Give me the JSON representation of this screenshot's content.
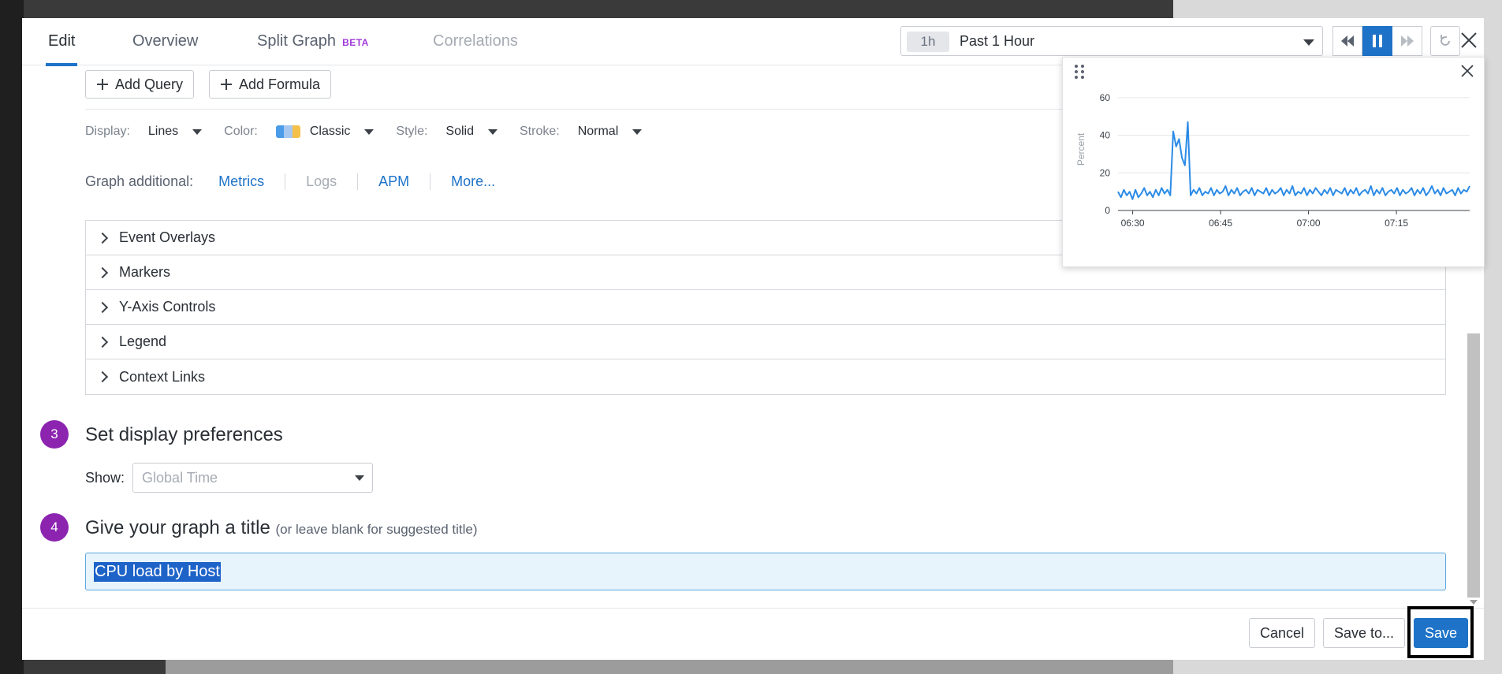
{
  "tabs": [
    {
      "label": "Edit"
    },
    {
      "label": "Overview"
    },
    {
      "label": "Split Graph",
      "badge": "BETA"
    },
    {
      "label": "Correlations"
    }
  ],
  "timepicker": {
    "badge": "1h",
    "label": "Past 1 Hour"
  },
  "buttons": {
    "add_query": "Add Query",
    "add_formula": "Add Formula"
  },
  "display": {
    "display_label": "Display:",
    "display_value": "Lines",
    "color_label": "Color:",
    "color_value": "Classic",
    "style_label": "Style:",
    "style_value": "Solid",
    "stroke_label": "Stroke:",
    "stroke_value": "Normal",
    "palette": [
      "#4a9be8",
      "#a6c8f0",
      "#f5c04a"
    ]
  },
  "graph_additional": {
    "label": "Graph additional:",
    "links": [
      {
        "label": "Metrics",
        "enabled": true
      },
      {
        "label": "Logs",
        "enabled": false
      },
      {
        "label": "APM",
        "enabled": true
      },
      {
        "label": "More...",
        "enabled": true
      }
    ]
  },
  "accordion": [
    "Event Overlays",
    "Markers",
    "Y-Axis Controls",
    "Legend",
    "Context Links"
  ],
  "step3": {
    "number": "3",
    "title": "Set display preferences",
    "show_label": "Show:",
    "show_value": "Global Time"
  },
  "step4": {
    "number": "4",
    "title": "Give your graph a title",
    "subtitle": "(or leave blank for suggested title)",
    "value": "CPU load by Host"
  },
  "footer_buttons": {
    "cancel": "Cancel",
    "save_to": "Save to...",
    "save": "Save"
  },
  "colors": {
    "accent": "#1e73c8",
    "step": "#8c24b0",
    "series": "#2b8be6"
  },
  "chart_data": {
    "type": "line",
    "ylabel": "Percent",
    "ylim": [
      0,
      65
    ],
    "yticks": [
      0,
      20,
      40,
      60
    ],
    "xticks": [
      "06:30",
      "06:45",
      "07:00",
      "07:15"
    ],
    "x_range_minutes": [
      0,
      60
    ],
    "x_tick_minutes": [
      2.5,
      17.5,
      32.5,
      47.5
    ],
    "series": [
      {
        "values": [
          10,
          7,
          11,
          8,
          10,
          6,
          11,
          7,
          9,
          12,
          8,
          10,
          7,
          11,
          8,
          12,
          9,
          11,
          8,
          42,
          34,
          38,
          28,
          24,
          47,
          8,
          11,
          9,
          12,
          8,
          10,
          9,
          12,
          8,
          11,
          9,
          10,
          13,
          8,
          11,
          9,
          12,
          8,
          10,
          11,
          9,
          12,
          8,
          11,
          10,
          9,
          12,
          8,
          11,
          9,
          10,
          12,
          8,
          11,
          9,
          13,
          8,
          10,
          9,
          12,
          8,
          11,
          9,
          12,
          10,
          8,
          11,
          9,
          12,
          8,
          11,
          10,
          9,
          12,
          8,
          11,
          9,
          12,
          8,
          10,
          11,
          9,
          13,
          8,
          11,
          9,
          12,
          8,
          10,
          11,
          9,
          12,
          8,
          11,
          9,
          10,
          12,
          8,
          11,
          9,
          12,
          8,
          10,
          13,
          9,
          11,
          8,
          12,
          9,
          10,
          11,
          8,
          12,
          9,
          11,
          10,
          13
        ]
      }
    ]
  }
}
